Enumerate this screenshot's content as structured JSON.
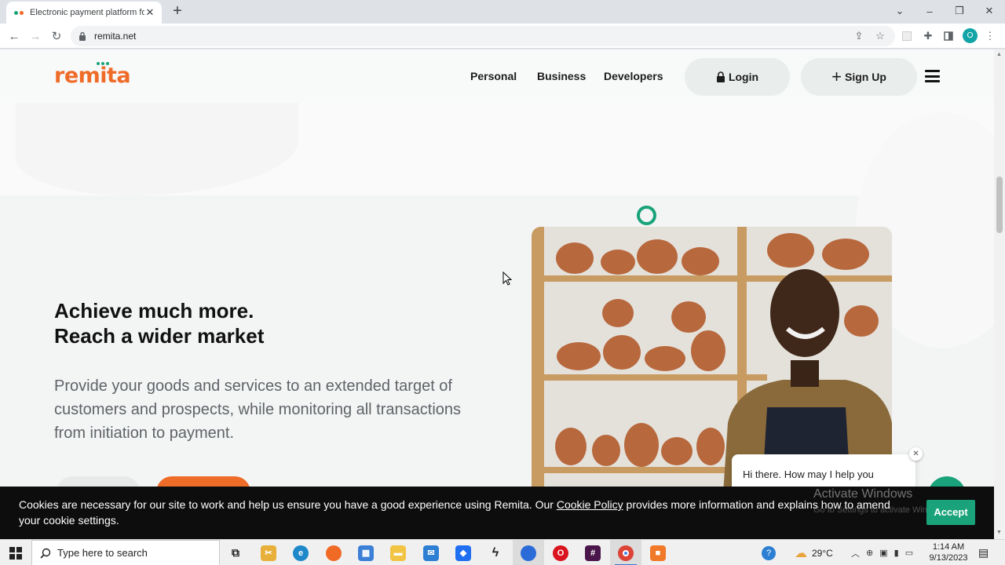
{
  "browser": {
    "tab_title": "Electronic payment platform for",
    "url": "remita.net",
    "profile_initial": "O",
    "colors": {
      "profile": "#12a4a6"
    }
  },
  "site": {
    "logo": "remita",
    "nav": [
      "Personal",
      "Business",
      "Developers"
    ],
    "login_label": "Login",
    "signup_label": "Sign Up",
    "brand_colors": {
      "orange": "#ef6b28",
      "green": "#1aa37a"
    }
  },
  "hero": {
    "headline_line1": "Achieve much more.",
    "headline_line2": "Reach a wider market",
    "subtext": "Provide your goods and services to an extended target of customers and prospects, while monitoring all transactions from initiation to payment."
  },
  "chat": {
    "greeting": "Hi there. How may I help you"
  },
  "cookie": {
    "text_before": "Cookies are necessary for our site to work and help us ensure you have a good experience using Remita. Our ",
    "link": "Cookie Policy",
    "text_after": " provides more information and explains how to amend your cookie settings.",
    "accept_label": "Accept"
  },
  "watermark": {
    "title": "Activate Windows",
    "subtitle": "Go to Settings to activate Windows."
  },
  "taskbar": {
    "search_placeholder": "Type here to search",
    "temperature": "29°C",
    "time": "1:14 AM",
    "date": "9/13/2023"
  }
}
